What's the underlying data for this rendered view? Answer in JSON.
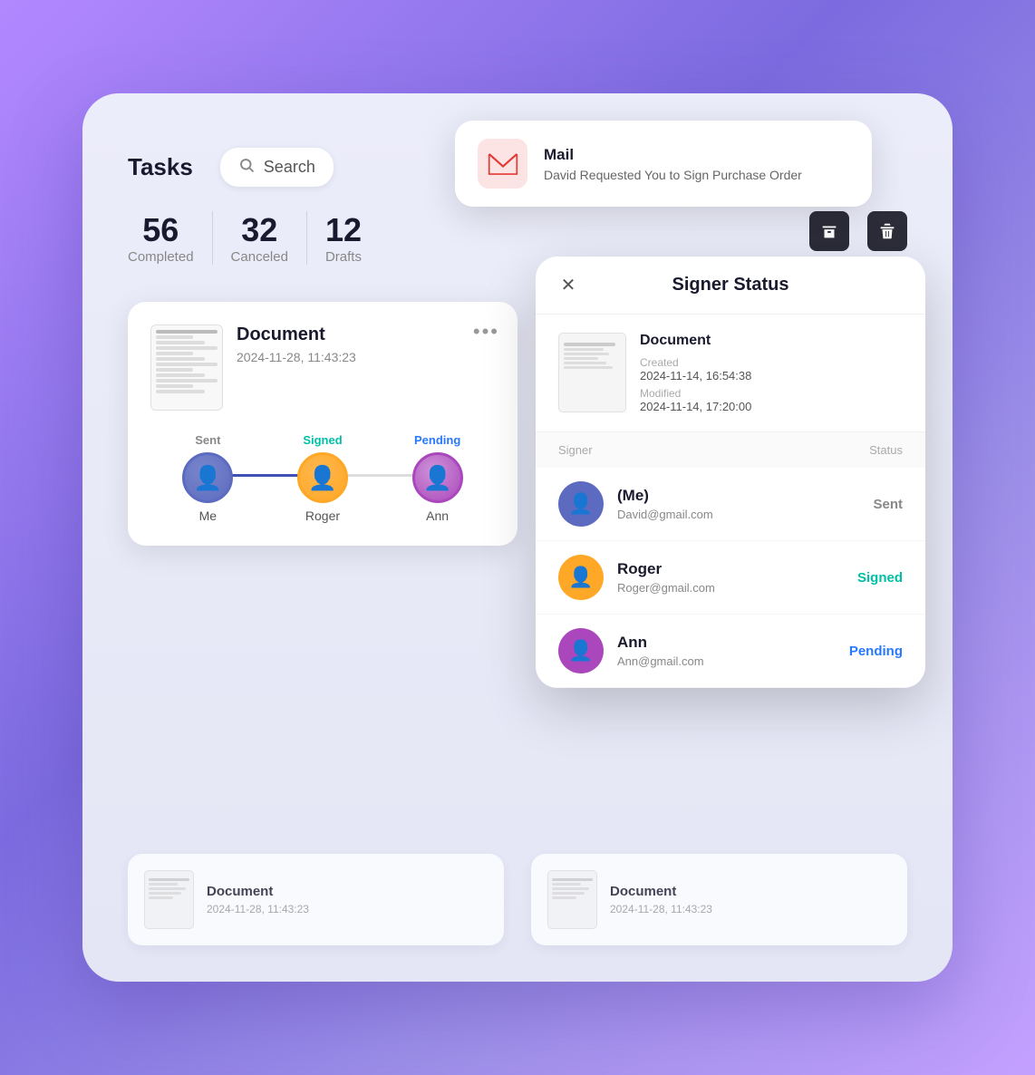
{
  "app": {
    "title": "Tasks",
    "search_placeholder": "Search"
  },
  "stats": [
    {
      "number": "56",
      "label": "Completed"
    },
    {
      "number": "32",
      "label": "Canceled"
    },
    {
      "number": "12",
      "label": "Drafts"
    }
  ],
  "mail_notification": {
    "app_name": "Mail",
    "message": "David Requested You to Sign Purchase Order"
  },
  "main_doc_card": {
    "title": "Document",
    "date": "2024-11-28, 11:43:23",
    "menu": "•••",
    "signers": [
      {
        "label": "Sent",
        "name": "Me",
        "avatar_type": "me"
      },
      {
        "label": "Signed",
        "name": "Roger",
        "avatar_type": "roger"
      },
      {
        "label": "Pending",
        "name": "Ann",
        "avatar_type": "ann"
      }
    ]
  },
  "signer_modal": {
    "title": "Signer Status",
    "close_label": "✕",
    "document": {
      "name": "Document",
      "created_label": "Created",
      "created_value": "2024-11-14, 16:54:38",
      "modified_label": "Modified",
      "modified_value": "2024-11-14, 17:20:00"
    },
    "table_headers": {
      "signer": "Signer",
      "status": "Status"
    },
    "signers": [
      {
        "name": "(Me)",
        "email": "David@gmail.com",
        "status": "Sent",
        "status_class": "status-sent",
        "avatar_class": "me-avatar"
      },
      {
        "name": "Roger",
        "email": "Roger@gmail.com",
        "status": "Signed",
        "status_class": "status-signed",
        "avatar_class": "roger-avatar"
      },
      {
        "name": "Ann",
        "email": "Ann@gmail.com",
        "status": "Pending",
        "status_class": "status-pending",
        "avatar_class": "ann-avatar"
      }
    ]
  },
  "bottom_docs": [
    {
      "title": "Document",
      "date": "2024-11-28, 11:43:23"
    },
    {
      "title": "Document",
      "date": "2024-11-28, 11:43:23"
    }
  ]
}
